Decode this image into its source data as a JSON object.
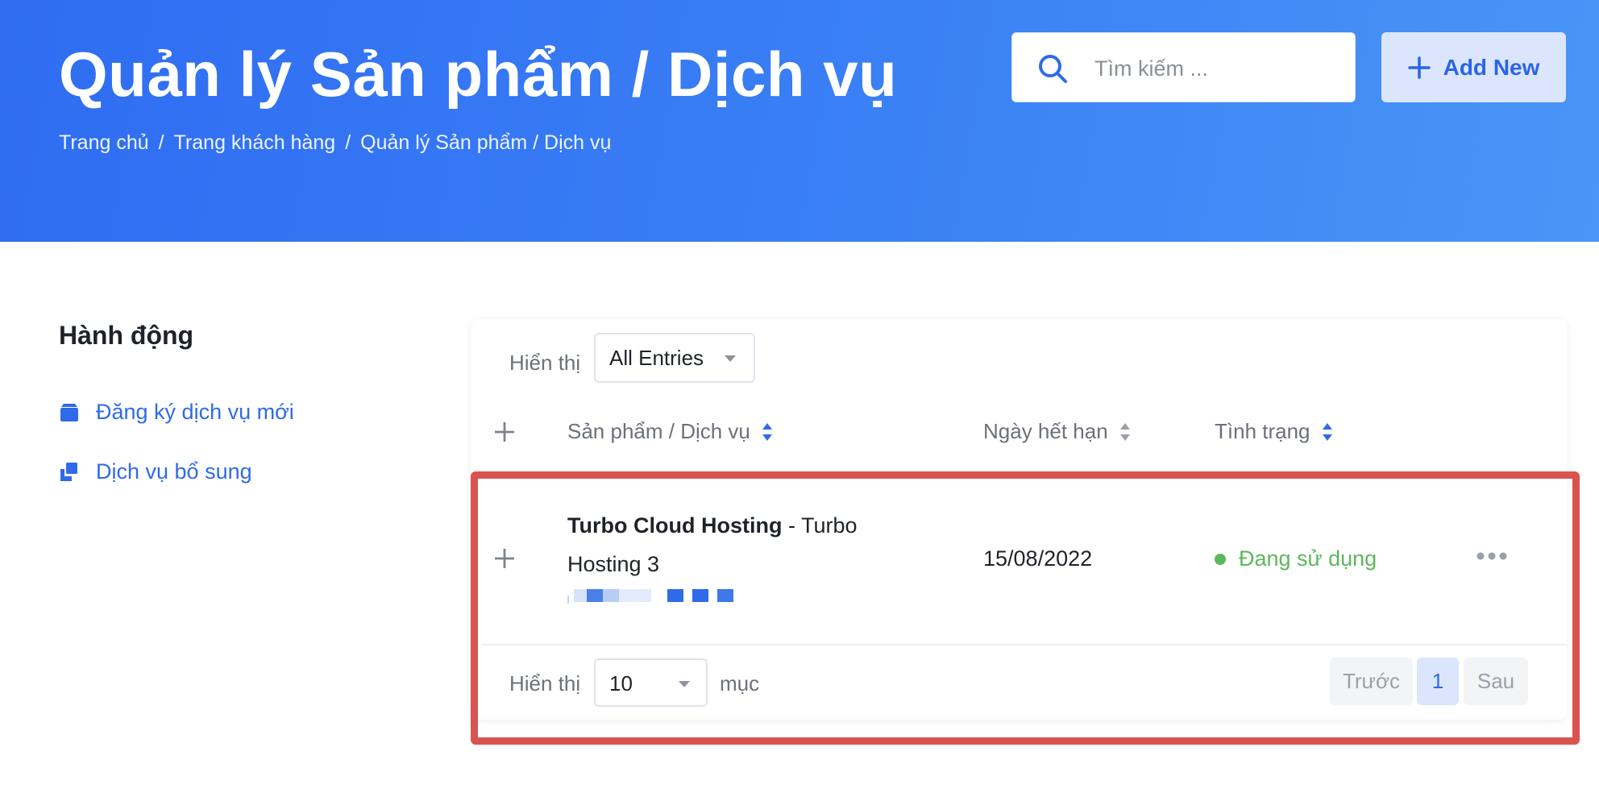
{
  "header": {
    "title": "Quản lý Sản phẩm / Dịch vụ",
    "breadcrumb": [
      "Trang chủ",
      "Trang khách hàng",
      "Quản lý Sản phẩm / Dịch vụ"
    ],
    "breadcrumb_separator": "/",
    "search_placeholder": "Tìm kiếm ...",
    "add_button_label": "Add New",
    "gradient_start": "#2f6cf2",
    "gradient_end": "#4a95f7"
  },
  "sidebar": {
    "title": "Hành động",
    "items": [
      {
        "label": "Đăng ký dịch vụ mới",
        "icon": "box-icon"
      },
      {
        "label": "Dịch vụ bổ sung",
        "icon": "layers-icon"
      }
    ]
  },
  "table": {
    "show_label": "Hiển thị",
    "entries_select": "All Entries",
    "columns": [
      "Sản phẩm / Dịch vụ",
      "Ngày hết hạn",
      "Tình trạng"
    ],
    "rows": [
      {
        "product_name": "Turbo Cloud Hosting",
        "product_plan": " - Turbo Hosting 3",
        "expiry": "15/08/2022",
        "status": "Đang sử dụng",
        "status_color": "#5cb85c"
      }
    ],
    "footer": {
      "show_label": "Hiển thị",
      "per_page": "10",
      "unit": "mục",
      "prev": "Trước",
      "current_page": "1",
      "next": "Sau"
    }
  },
  "colors": {
    "accent": "#2f6be8",
    "highlight_border": "#d9534f"
  }
}
